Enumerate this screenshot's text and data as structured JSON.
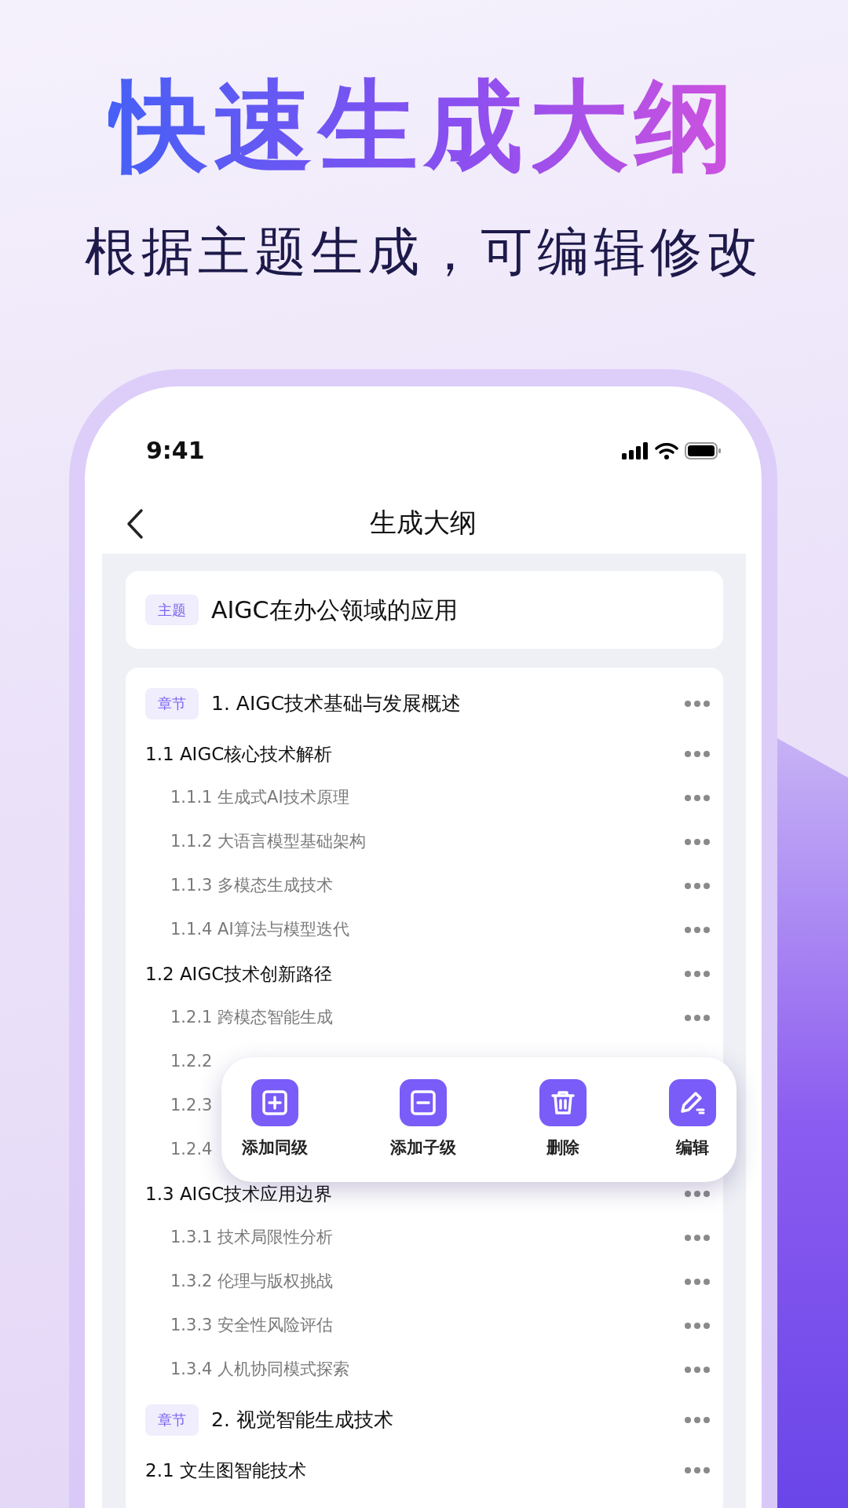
{
  "headline": "快速生成大纲",
  "subtitle": "根据主题生成，可编辑修改",
  "status_bar": {
    "time": "9:41"
  },
  "nav": {
    "title": "生成大纲"
  },
  "topic": {
    "tag": "主题",
    "title": "AIGC在办公领域的应用"
  },
  "outline": [
    {
      "tag": "章节",
      "title": "1. AIGC技术基础与发展概述",
      "children": [
        {
          "title": "1.1 AIGC核心技术解析",
          "children": [
            {
              "title": "1.1.1 生成式AI技术原理"
            },
            {
              "title": "1.1.2 大语言模型基础架构"
            },
            {
              "title": "1.1.3 多模态生成技术"
            },
            {
              "title": "1.1.4 AI算法与模型迭代"
            }
          ]
        },
        {
          "title": "1.2 AIGC技术创新路径",
          "children": [
            {
              "title": "1.2.1 跨模态智能生成"
            },
            {
              "title": "1.2.2"
            },
            {
              "title": "1.2.3"
            },
            {
              "title": "1.2.4"
            }
          ]
        },
        {
          "title": "1.3 AIGC技术应用边界",
          "children": [
            {
              "title": "1.3.1 技术局限性分析"
            },
            {
              "title": "1.3.2 伦理与版权挑战"
            },
            {
              "title": "1.3.3 安全性风险评估"
            },
            {
              "title": "1.3.4 人机协同模式探索"
            }
          ]
        }
      ]
    },
    {
      "tag": "章节",
      "title": "2. 视觉智能生成技术",
      "children": [
        {
          "title": "2.1 文生图智能技术"
        }
      ]
    }
  ],
  "context_menu": {
    "items": [
      {
        "kind": "add",
        "label": "添加同级"
      },
      {
        "kind": "remove",
        "label": "添加子级"
      },
      {
        "kind": "delete",
        "label": "删除"
      },
      {
        "kind": "edit",
        "label": "编辑"
      }
    ]
  }
}
